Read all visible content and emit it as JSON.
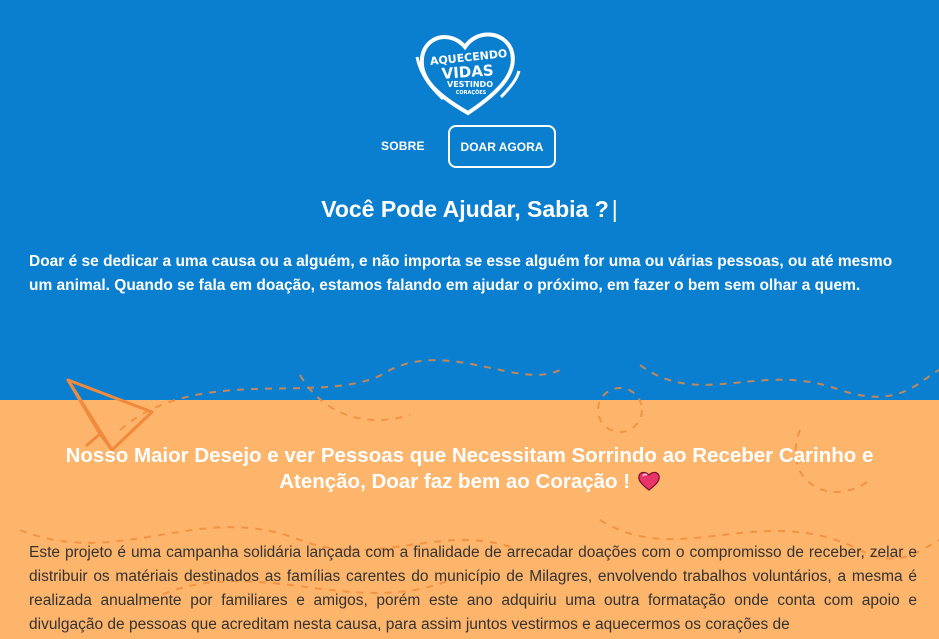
{
  "brand": {
    "logo_lines": [
      "AQUECENDO",
      "VIDAS",
      "VESTINDO",
      "CORAÇÕES"
    ]
  },
  "nav": {
    "sobre_label": "SOBRE",
    "doar_label": "DOAR AGORA"
  },
  "hero": {
    "title": "Você Pode Ajudar, Sabia ?",
    "cursor": "|",
    "text": "Doar é se dedicar a uma causa ou a alguém, e não importa se esse alguém for uma ou várias pessoas, ou até mesmo um animal. Quando se fala em doação, estamos falando em ajudar o próximo, em fazer o bem sem olhar a quem."
  },
  "section": {
    "title": "Nosso Maior Desejo e ver Pessoas que Necessitam Sorrindo ao Receber Carinho e Atenção, Doar faz bem ao Coração !",
    "body": "Este projeto é uma campanha solidária lançada com a finalidade de arrecadar doações com o compromisso de receber, zelar e distribuir os matériais destinados as famílias carentes do município de Milagres, envolvendo trabalhos voluntários, a mesma é realizada anualmente por familiares e amigos, porém este ano adquiriu uma outra formatação onde conta com apoio e divulgação de pessoas que acreditam nesta causa, para assim juntos vestirmos e aquecermos os corações de"
  },
  "colors": {
    "hero_blue": "#0a7fd0",
    "section_orange": "#fdb46b",
    "doodle": "#f08a3c",
    "heart": "#e8336b"
  },
  "icons": [
    "paper-plane-icon",
    "heart-icon"
  ]
}
